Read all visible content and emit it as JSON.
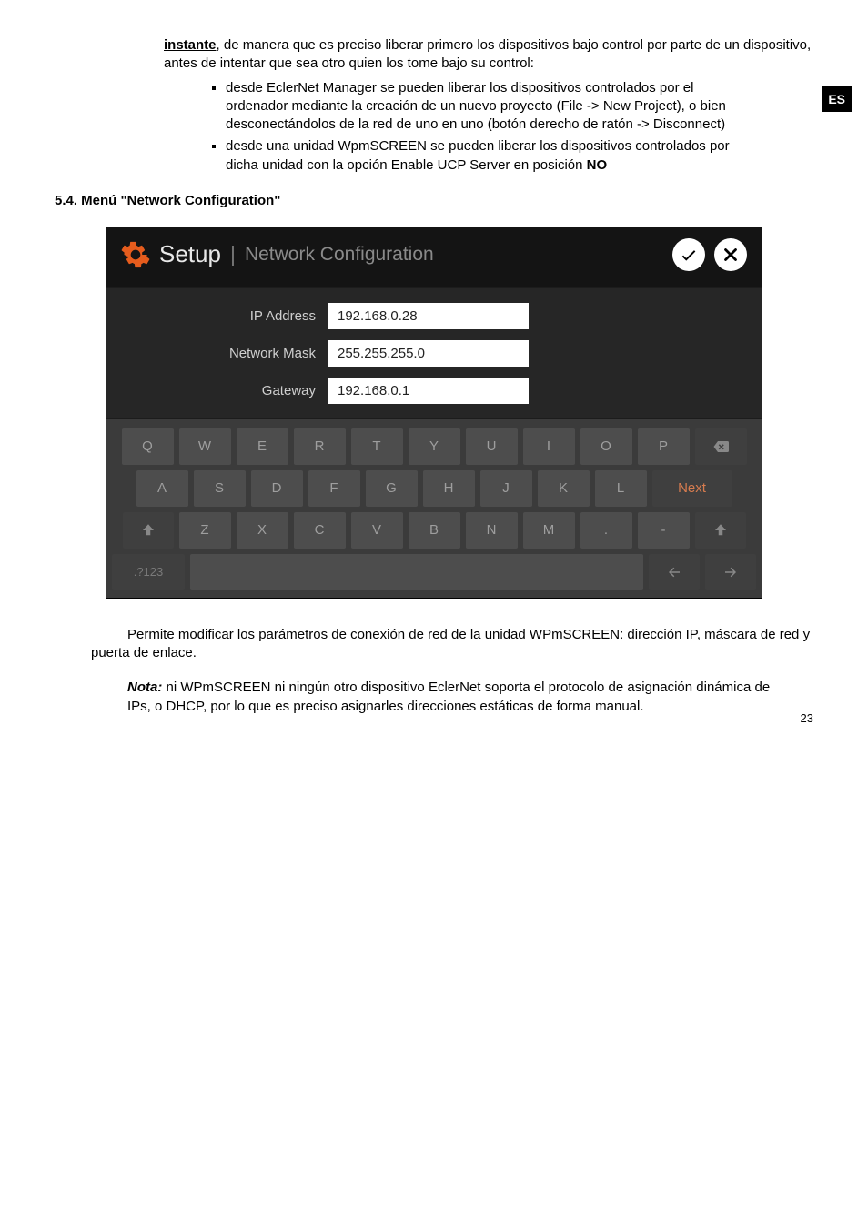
{
  "lang_badge": "ES",
  "intro": {
    "underlined_word": "instante",
    "rest": ", de manera que es preciso liberar primero los dispositivos bajo control por parte de un dispositivo, antes de intentar que sea otro quien los tome bajo su control:"
  },
  "bullets": [
    "desde EclerNet Manager se pueden liberar los dispositivos controlados por el ordenador mediante la creación de un nuevo proyecto (File -> New Project), o bien desconectándolos de la red de uno en uno (botón derecho de ratón -> Disconnect)",
    "desde una unidad WpmSCREEN se pueden liberar los dispositivos controlados por dicha unidad con la opción Enable UCP Server en posición NO"
  ],
  "bullet2_prefix": "desde una unidad WpmSCREEN se pueden liberar los dispositivos controlados por dicha unidad con la opción Enable UCP Server en posición ",
  "bullet2_bold": "NO",
  "section_heading": "5.4. Menú \"Network Configuration\"",
  "panel": {
    "title": "Setup",
    "subtitle": "Network Configuration",
    "confirm_icon": "check",
    "cancel_icon": "close"
  },
  "form": {
    "ip_label": "IP Address",
    "ip_value": "192.168.0.28",
    "mask_label": "Network Mask",
    "mask_value": "255.255.255.0",
    "gw_label": "Gateway",
    "gw_value": "192.168.0.1"
  },
  "keyboard": {
    "row1": [
      "Q",
      "W",
      "E",
      "R",
      "T",
      "Y",
      "U",
      "I",
      "O",
      "P"
    ],
    "row2": [
      "A",
      "S",
      "D",
      "F",
      "G",
      "H",
      "J",
      "K",
      "L"
    ],
    "row3": [
      "Z",
      "X",
      "C",
      "V",
      "B",
      "N",
      "M",
      ".",
      "-"
    ],
    "next_label": "Next",
    "alt_label": ".?123",
    "backspace_icon": "backspace",
    "shift_icon": "shift",
    "left_icon": "arrow-left",
    "right_icon": "arrow-right"
  },
  "body_para": "Permite modificar los parámetros de conexión de red de la unidad WPmSCREEN: dirección IP, máscara de red y puerta de enlace.",
  "note": {
    "label": "Nota:",
    "text": " ni WPmSCREEN ni ningún otro dispositivo EclerNet soporta el protocolo de asignación dinámica de IPs, o DHCP, por lo que es preciso asignarles direcciones estáticas de forma manual."
  },
  "page_number": "23"
}
